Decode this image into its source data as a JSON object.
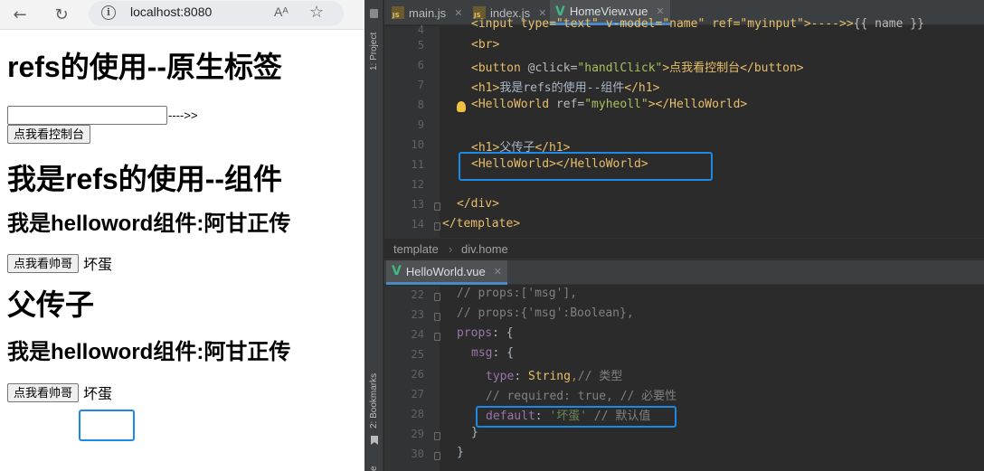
{
  "browser": {
    "address": "localhost:8080",
    "read_aloud_glyph": "Aᴬ",
    "page": {
      "h1_native": "refs的使用--原生标签",
      "arrow_text": "---->>",
      "button_console": "点我看控制台",
      "h1_component": "我是refs的使用--组件",
      "component_title_1": "我是helloword组件:阿甘正传",
      "button_handsome_1": "点我看帅哥",
      "value_1": "坏蛋",
      "h1_parent_child": "父传子",
      "component_title_2": "我是helloword组件:阿甘正传",
      "button_handsome_2": "点我看帅哥",
      "value_2": "坏蛋"
    }
  },
  "ide": {
    "side_tools": {
      "project": "1: Project",
      "bookmarks": "2: Bookmarks",
      "bottom": "e"
    },
    "top_tabs": [
      {
        "label": "main.js",
        "icon": "js-file-icon"
      },
      {
        "label": "index.js",
        "icon": "js-file-icon"
      },
      {
        "label": "HomeView.vue",
        "icon": "vue-file-icon",
        "active": true
      }
    ],
    "breadcrumb": [
      "template",
      "div.home"
    ],
    "bottom_tab": {
      "label": "HelloWorld.vue",
      "icon": "vue-file-icon"
    },
    "top_editor": {
      "line_numbers": [
        "4",
        "5",
        "6",
        "7",
        "8",
        "9",
        "10",
        "11",
        "12",
        "13",
        "14"
      ],
      "lines": {
        "l4": [
          "<input type=\"text\" v-model=\"name\" ref=\"myinput\">---->>",
          "{{ name }}"
        ],
        "l5": "<br>",
        "l6": [
          "<button",
          " @click=",
          "\"handlClick\"",
          ">点我看控制台</",
          "button",
          ">"
        ],
        "l7": [
          "<h1>",
          "我是refs的使用--组件",
          "</h1>"
        ],
        "l8": [
          "<HelloWorld",
          " ref=",
          "\"myheoll\"",
          "></HelloWorld>"
        ],
        "l10": [
          "<h1>",
          "父传子",
          "</h1>"
        ],
        "l11": "<HelloWorld></HelloWorld>",
        "l13": "</div>",
        "l14": "</template>"
      }
    },
    "bottom_editor": {
      "line_numbers": [
        "22",
        "23",
        "24",
        "25",
        "26",
        "27",
        "28",
        "29",
        "30"
      ],
      "lines": {
        "l22": "// props:['msg'],",
        "l23": "// props:{'msg':Boolean},",
        "l24": [
          "props",
          ": {"
        ],
        "l25": [
          "msg",
          ": {"
        ],
        "l26": [
          "type",
          ": ",
          "String",
          ",",
          "// 类型"
        ],
        "l27": "// required: true, // 必要性",
        "l28": [
          "default",
          ": ",
          "'坏蛋'",
          " // 默认值"
        ],
        "l29": "}",
        "l30": "}"
      }
    },
    "colors": {
      "highlight_box": "#1e88e5",
      "tag": "#e8bf6a",
      "string": "#a5c25c",
      "comment": "#808080"
    }
  }
}
